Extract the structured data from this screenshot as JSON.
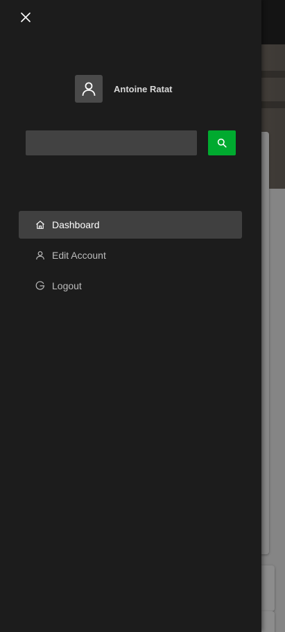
{
  "drawer": {
    "close_icon": "close-icon",
    "user": {
      "name": "Antoine Ratat",
      "avatar_icon": "user-icon"
    },
    "search": {
      "value": "",
      "placeholder": "",
      "button_icon": "search-icon"
    },
    "nav": [
      {
        "label": "Dashboard",
        "icon": "home-icon",
        "active": true
      },
      {
        "label": "Edit Account",
        "icon": "user-icon",
        "active": false
      },
      {
        "label": "Logout",
        "icon": "logout-icon",
        "active": false
      }
    ]
  },
  "colors": {
    "drawer_bg": "#1c1c1c",
    "active_item_bg": "#404040",
    "search_button": "#00aa2f"
  }
}
